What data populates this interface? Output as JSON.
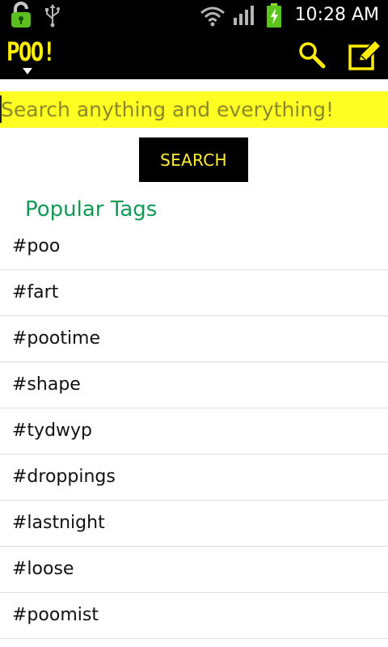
{
  "status_bar": {
    "time": "10:28 AM",
    "icons": [
      "lock-icon",
      "usb-icon",
      "wifi-icon",
      "signal-icon",
      "battery-charging-icon"
    ]
  },
  "action_bar": {
    "logo_text": "POO!",
    "icons": [
      "search-icon",
      "compose-icon"
    ]
  },
  "search": {
    "value": "",
    "placeholder": "Search anything and everything!",
    "button_label": "SEARCH"
  },
  "popular": {
    "title": "Popular Tags",
    "tags": [
      "#poo",
      "#fart",
      "#pootime",
      "#shape",
      "#tydwyp",
      "#droppings",
      "#lastnight",
      "#loose",
      "#poomist"
    ]
  },
  "colors": {
    "accent_yellow": "#ffee00",
    "search_field_bg": "#ffff23",
    "title_green": "#109a55",
    "bar_bg": "#000000"
  }
}
